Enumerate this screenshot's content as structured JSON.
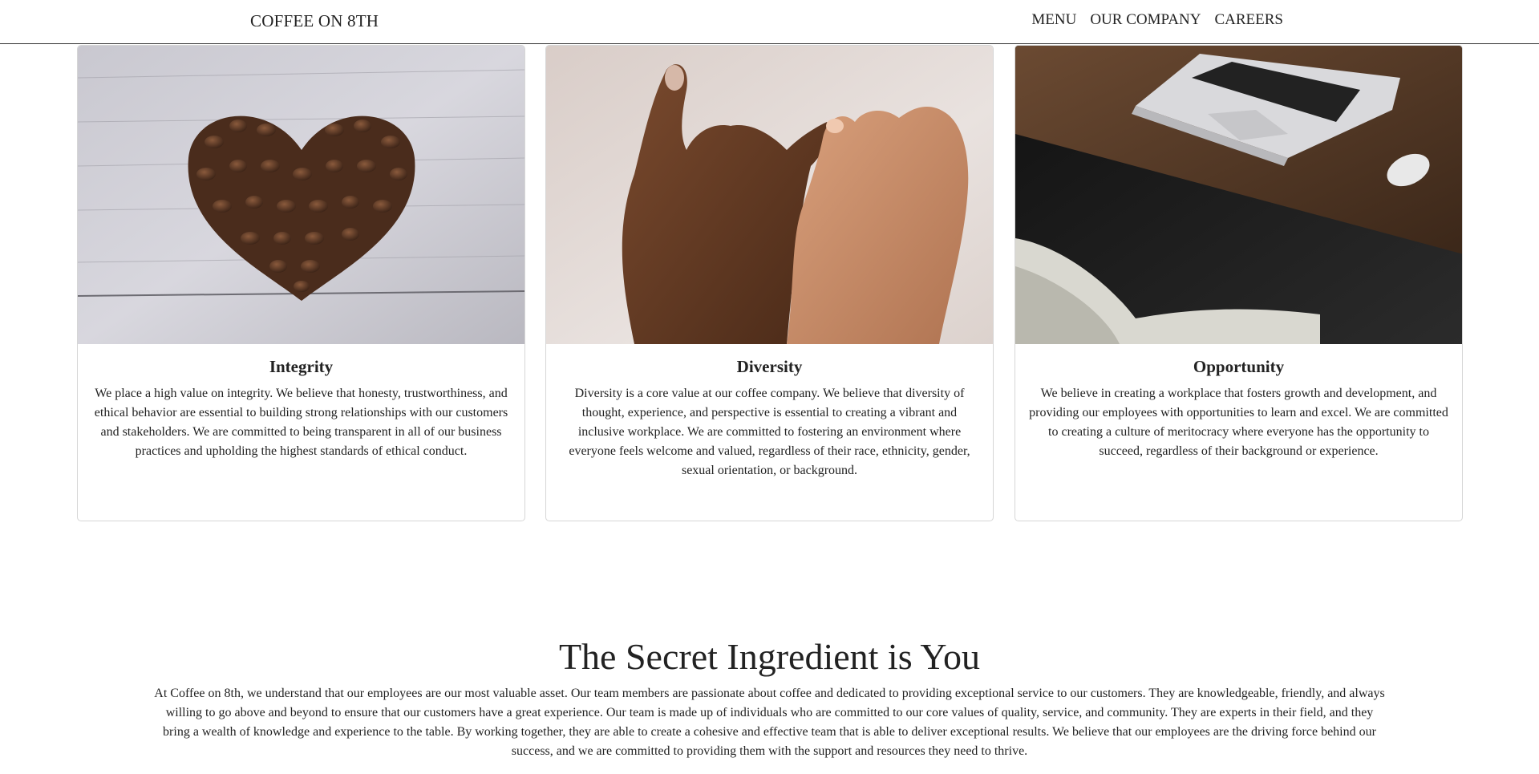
{
  "navbar": {
    "brand": "COFFEE ON 8TH",
    "links": [
      "MENU",
      "OUR COMPANY",
      "CAREERS"
    ]
  },
  "cards": [
    {
      "image": "coffee-beans-heart-photo",
      "title": "Integrity",
      "text": "We place a high value on integrity. We believe that honesty, trustworthiness, and ethical behavior are essential to building strong relationships with our customers and stakeholders. We are committed to being transparent in all of our business practices and upholding the highest standards of ethical conduct."
    },
    {
      "image": "pinky-promise-hands-photo",
      "title": "Diversity",
      "text": "Diversity is a core value at our coffee company. We believe that diversity of thought, experience, and perspective is essential to creating a vibrant and inclusive workplace. We are committed to fostering an environment where everyone feels welcome and valued, regardless of their race, ethnicity, gender, sexual orientation, or background."
    },
    {
      "image": "laptop-desk-chair-photo",
      "title": "Opportunity",
      "text": "We believe in creating a workplace that fosters growth and development, and providing our employees with opportunities to learn and excel. We are committed to creating a culture of meritocracy where everyone has the opportunity to succeed, regardless of their background or experience."
    }
  ],
  "section": {
    "title": "The Secret Ingredient is You",
    "text": "At Coffee on 8th, we understand that our employees are our most valuable asset. Our team members are passionate about coffee and dedicated to providing exceptional service to our customers. They are knowledgeable, friendly, and always willing to go above and beyond to ensure that our customers have a great experience. Our team is made up of individuals who are committed to our core values of quality, service, and community. They are experts in their field, and they bring a wealth of knowledge and experience to the table. By working together, they are able to create a cohesive and effective team that is able to deliver exceptional results. We believe that our employees are the driving force behind our success, and we are committed to providing them with the support and resources they need to thrive."
  },
  "colors": {
    "text": "#222222",
    "border": "#d6d6d6",
    "navbar_border": "#333333"
  }
}
